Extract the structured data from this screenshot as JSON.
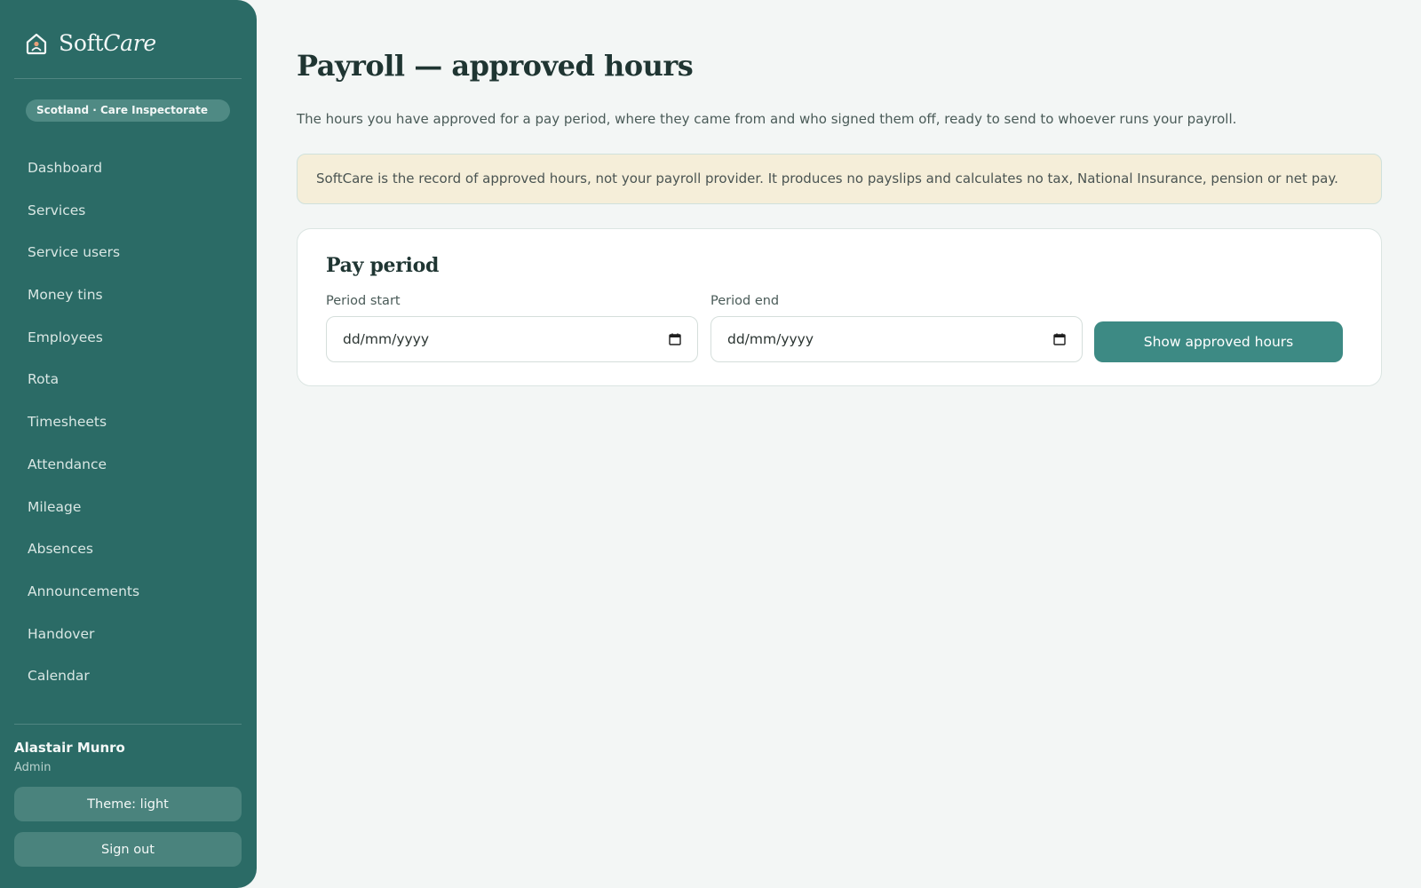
{
  "brand": {
    "name_plain": "Soft",
    "name_italic": "Care"
  },
  "sidebar": {
    "region": "Scotland · Care Inspectorate",
    "items": [
      {
        "label": "Dashboard"
      },
      {
        "label": "Services"
      },
      {
        "label": "Service users"
      },
      {
        "label": "Money tins"
      },
      {
        "label": "Employees"
      },
      {
        "label": "Rota"
      },
      {
        "label": "Timesheets"
      },
      {
        "label": "Attendance"
      },
      {
        "label": "Mileage"
      },
      {
        "label": "Absences"
      },
      {
        "label": "Announcements"
      },
      {
        "label": "Handover"
      },
      {
        "label": "Calendar"
      }
    ],
    "user": {
      "name": "Alastair Munro",
      "role": "Admin"
    },
    "theme_button": "Theme: light",
    "signout_button": "Sign out"
  },
  "main": {
    "title": "Payroll — approved hours",
    "description": "The hours you have approved for a pay period, where they came from and who signed them off, ready to send to whoever runs your payroll.",
    "notice": "SoftCare is the record of approved hours, not your payroll provider. It produces no payslips and calculates no tax, National Insurance, pension or net pay.",
    "pay_period": {
      "title": "Pay period",
      "start": {
        "label": "Period start",
        "placeholder": "dd/mm/yyyy"
      },
      "end": {
        "label": "Period end",
        "placeholder": "dd/mm/yyyy"
      },
      "submit": "Show approved hours"
    }
  },
  "colors": {
    "sidebar": "#2b6b66",
    "primary_button": "#3d8a84",
    "notice_bg": "#f5eed9",
    "page_bg": "#f3f6f5"
  },
  "icons": [
    "home-heart-icon",
    "calendar-icon"
  ]
}
